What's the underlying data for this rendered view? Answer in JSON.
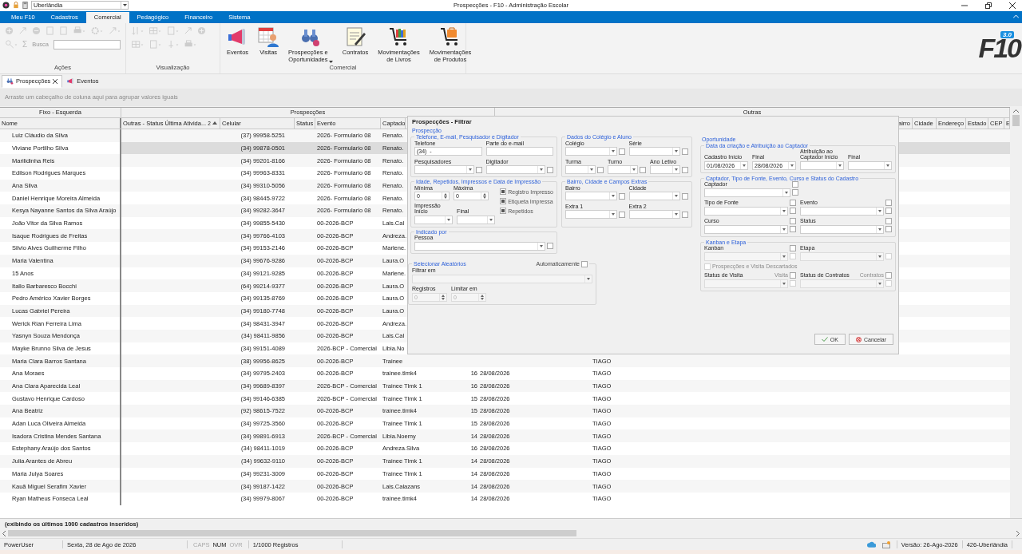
{
  "window": {
    "title": "Prospecções - F10 - Administração Escolar",
    "location": "Uberlândia"
  },
  "ribbon": {
    "tabs": [
      {
        "label": "Meu F10",
        "selected": false
      },
      {
        "label": "Cadastros",
        "selected": false
      },
      {
        "label": "Comercial",
        "selected": true
      },
      {
        "label": "Pedagógico",
        "selected": false
      },
      {
        "label": "Financeiro",
        "selected": false
      },
      {
        "label": "Sistema",
        "selected": false
      }
    ],
    "search_label": "Busca",
    "sum": "Σ",
    "groups": [
      {
        "label": "Ações"
      },
      {
        "label": "Visualização"
      },
      {
        "label": "Comercial"
      }
    ],
    "buttons": [
      {
        "label": "Eventos",
        "kind": "megaphone",
        "dropdown": false
      },
      {
        "label": "Visitas",
        "kind": "calendar",
        "dropdown": false
      },
      {
        "label": "Prospecções e\nOportunidades",
        "kind": "binoculars",
        "dropdown": true
      },
      {
        "label": "Contratos",
        "kind": "contract",
        "dropdown": false
      },
      {
        "label": "Movimentações\nde Livros",
        "kind": "cart-books",
        "dropdown": false
      },
      {
        "label": "Movimentações\nde Produtos",
        "kind": "cart-box",
        "dropdown": false
      }
    ],
    "logo": {
      "text": "F10",
      "version": "3.0"
    }
  },
  "doc_tabs": [
    {
      "label": "Prospecções",
      "selected": true,
      "closable": true
    },
    {
      "label": "Eventos",
      "selected": false,
      "closable": false
    }
  ],
  "group_panel": {
    "hint": "Arraste um cabeçalho de coluna aqui para agrupar valores iguais"
  },
  "grid": {
    "bands": [
      "Fixo - Esquerda",
      "Prospecções",
      "Outras"
    ],
    "columns": [
      "Nome",
      "Outras - Status Última Ativida...",
      "Celular",
      "Status",
      "Evento",
      "Captado"
    ],
    "sort": {
      "index": "2"
    },
    "right_columns": [
      "airro",
      "Cidade",
      "Endereço",
      "Estado",
      "CEP",
      "E"
    ],
    "rows": [
      {
        "nome": "Luiz Cláudio da Silva",
        "celular": "(37) 99958-5251",
        "evento": "2026- Formulario 08",
        "captador": "Renato.",
        "selected": false
      },
      {
        "nome": "Viviane Portilho Silva",
        "celular": "(34) 99878-0501",
        "evento": "2026- Formulario 08",
        "captador": "Renato.",
        "selected": true
      },
      {
        "nome": "Marilidinha Reis",
        "celular": "(34) 99201-8166",
        "evento": "2026- Formulario 08",
        "captador": "Renato.",
        "selected": false
      },
      {
        "nome": "Edilson Rodrigues Marques",
        "celular": "(34) 99963-8331",
        "evento": "2026- Formulario 08",
        "captador": "Renato.",
        "selected": false
      },
      {
        "nome": "Ana Silva",
        "celular": "(34) 99310-5056",
        "evento": "2026- Formulario 08",
        "captador": "Renato.",
        "selected": false
      },
      {
        "nome": "Daniel Henrique Moreira Almeida",
        "celular": "(34) 98445-9722",
        "evento": "2026- Formulario 08",
        "captador": "Renato.",
        "selected": false
      },
      {
        "nome": "Kesya Nayanne Santos da Silva Araújo",
        "celular": "(34) 99282-3647",
        "evento": "2026- Formulario 08",
        "captador": "Renato.",
        "selected": false
      },
      {
        "nome": "João Vitor da Silva Ramos",
        "celular": "(34) 99855-5430",
        "evento": "00-2026-BCP",
        "captador": "Lais.Cal",
        "selected": false
      },
      {
        "nome": "Isaque Rodrigues de Freitas",
        "celular": "(34) 99766-4103",
        "evento": "00-2026-BCP",
        "captador": "Andreza.",
        "selected": false
      },
      {
        "nome": "Silvio Alves Guilherme Filho",
        "celular": "(34) 99153-2146",
        "evento": "00-2026-BCP",
        "captador": "Marlene.",
        "selected": false
      },
      {
        "nome": "Maria Valentina",
        "celular": "(34) 99676-9286",
        "evento": "00-2026-BCP",
        "captador": "Laura.O",
        "selected": false
      },
      {
        "nome": "15 Anos",
        "celular": "(34) 99121-9285",
        "evento": "00-2026-BCP",
        "captador": "Marlene.",
        "selected": false
      },
      {
        "nome": "Itallo Barbaresco Bocchi",
        "celular": "(64) 99214-9377",
        "evento": "00-2026-BCP",
        "captador": "Laura.O",
        "selected": false
      },
      {
        "nome": "Pedro Américo Xavier Borges",
        "celular": "(34) 99135-8769",
        "evento": "00-2026-BCP",
        "captador": "Laura.O",
        "selected": false
      },
      {
        "nome": "Lucas Gabriel Pereira",
        "celular": "(34) 99180-7748",
        "evento": "00-2026-BCP",
        "captador": "Laura.O",
        "selected": false
      },
      {
        "nome": "Werick Rian Ferreira Lima",
        "celular": "(34) 98431-3947",
        "evento": "00-2026-BCP",
        "captador": "Andreza.",
        "selected": false
      },
      {
        "nome": "Yasnyn Souza Mendonça",
        "celular": "(34) 98411-9856",
        "evento": "00-2026-BCP",
        "captador": "Lais.Cal",
        "selected": false
      },
      {
        "nome": "Mayke Brunno Silva de Jesus",
        "celular": "(34) 99151-4089",
        "evento": "2026-BCP - Comercial",
        "captador": "Libia.No",
        "selected": false
      },
      {
        "nome": "Maria Clara Barros Santana",
        "celular": "(38) 99956-8625",
        "evento": "00-2026-BCP",
        "captador": "Trainee",
        "column_9": "TIAGO",
        "selected": false
      },
      {
        "nome": "Ana Moraes",
        "celular": "(34) 99795-2403",
        "evento": "00-2026-BCP",
        "captador": "trainee.tlmk4",
        "column_7": "16",
        "column_8": "28/08/2026",
        "column_9": "TIAGO",
        "selected": false
      },
      {
        "nome": "Ana Clara Aparecida Leal",
        "celular": "(34) 99689-8397",
        "evento": "2026-BCP - Comercial",
        "captador": "Trainee Tlmk 1",
        "column_7": "16",
        "column_8": "28/08/2026",
        "column_9": "TIAGO",
        "selected": false
      },
      {
        "nome": "Gustavo Henrique Cardoso",
        "celular": "(34) 99146-6385",
        "evento": "2026-BCP - Comercial",
        "captador": "Trainee Tlmk 1",
        "column_7": "15",
        "column_8": "28/08/2026",
        "column_9": "TIAGO",
        "selected": false
      },
      {
        "nome": "Ana Beatriz",
        "celular": "(92) 98615-7522",
        "evento": "00-2026-BCP",
        "captador": "trainee.tlmk4",
        "column_7": "15",
        "column_8": "28/08/2026",
        "column_9": "TIAGO",
        "selected": false
      },
      {
        "nome": "Adan Luca Oliveira Almeida",
        "celular": "(34) 99725-3560",
        "evento": "00-2026-BCP",
        "captador": "Trainee Tlmk 1",
        "column_7": "15",
        "column_8": "28/08/2026",
        "column_9": "TIAGO",
        "selected": false
      },
      {
        "nome": "Isadora Cristina Mendes Santana",
        "celular": "(34) 99891-6913",
        "evento": "2026-BCP - Comercial",
        "captador": "Libia.Noemy",
        "column_7": "14",
        "column_8": "28/08/2026",
        "column_9": "TIAGO",
        "selected": false
      },
      {
        "nome": "Estephany Araújo dos Santos",
        "celular": "(34) 98411-1019",
        "evento": "00-2026-BCP",
        "captador": "Andreza.Silva",
        "column_7": "16",
        "column_8": "28/08/2026",
        "column_9": "TIAGO",
        "selected": false
      },
      {
        "nome": "Julia Arantes de Abreu",
        "celular": "(34) 99632-9110",
        "evento": "00-2026-BCP",
        "captador": "Trainee Tlmk 1",
        "column_7": "14",
        "column_8": "28/08/2026",
        "column_9": "TIAGO",
        "selected": false
      },
      {
        "nome": "Maria Julya Soares",
        "celular": "(34) 99231-3009",
        "evento": "00-2026-BCP",
        "captador": "Trainee Tlmk 1",
        "column_7": "14",
        "column_8": "28/08/2026",
        "column_9": "TIAGO",
        "selected": false
      },
      {
        "nome": "Kauã Miguel Serafim Xavier",
        "celular": "(34) 99187-1422",
        "evento": "00-2026-BCP",
        "captador": "Lais.Calazans",
        "column_7": "14",
        "column_8": "28/08/2026",
        "column_9": "TIAGO",
        "selected": false
      },
      {
        "nome": "Ryan Matheus Fonseca Leal",
        "celular": "(34) 99979-8067",
        "evento": "00-2026-BCP",
        "captador": "trainee.tlmk4",
        "column_7": "14",
        "column_8": "28/08/2026",
        "column_9": "TIAGO",
        "selected": false
      }
    ],
    "footer": "(exibindo os últimos 1000 cadastros inseridos)"
  },
  "filter_dialog": {
    "title": "Prospecções - Filtrar",
    "left": {
      "title": "Prospecção",
      "groups": [
        {
          "title": "Telefone, E-mail, Pesquisador e Digitador",
          "rows": [
            [
              {
                "label": "Telefone",
                "kind": "text",
                "value": "(34)  -",
                "disabled": false
              },
              {
                "label": "Parte do e-mail",
                "kind": "text",
                "disabled": false
              }
            ],
            [
              {
                "label": "Pesquisadores",
                "kind": "combo",
                "check": false,
                "disabled": false
              },
              {
                "label": "Digitador",
                "kind": "combo",
                "check": false,
                "disabled": false
              }
            ]
          ]
        },
        {
          "title": "Dados do Colégio e Aluno",
          "rows": [
            [
              {
                "label": "Colégio",
                "kind": "combo",
                "check": false,
                "disabled": false
              },
              {
                "label": "Série",
                "kind": "combo",
                "check": false,
                "disabled": false
              }
            ],
            [
              {
                "label": "Turma",
                "kind": "combo",
                "check": false,
                "disabled": false
              },
              {
                "label": "Turno",
                "kind": "combo",
                "check": false,
                "disabled": false
              },
              {
                "label": "Ano Letivo",
                "kind": "combo",
                "check": false,
                "disabled": false
              }
            ]
          ]
        },
        {
          "title": "Idade, Repetidos, Impressos e Data de Impressão",
          "rows": [
            [
              {
                "label": "Mínima",
                "kind": "spin",
                "value": "0",
                "disabled": false
              },
              {
                "label": "Máxima",
                "kind": "spin",
                "value": "0",
                "disabled": false
              }
            ],
            [
              {
                "label": "Impressão Início",
                "kind": "combo",
                "disabled": false
              },
              {
                "label": "Final",
                "kind": "combo",
                "disabled": false
              }
            ]
          ],
          "checks": [
            {
              "label": "Registro Impresso",
              "indeterminate": true
            },
            {
              "label": "Etiqueta Impressa",
              "indeterminate": true
            },
            {
              "label": "Repetidos",
              "indeterminate": true
            }
          ]
        },
        {
          "title": "Bairro, Cidade e Campos Extras",
          "rows": [
            [
              {
                "label": "Bairro",
                "kind": "combo",
                "check": false,
                "disabled": false
              },
              {
                "label": "Cidade",
                "kind": "combo",
                "check": false,
                "disabled": false
              }
            ],
            [
              {
                "label": "Extra 1",
                "kind": "combo",
                "check": false,
                "disabled": false
              },
              {
                "label": "Extra 2",
                "kind": "combo",
                "check": false,
                "disabled": false
              }
            ]
          ]
        },
        {
          "title": "Indicado por",
          "rows": [
            [
              {
                "label": "Pessoa",
                "kind": "combo",
                "check": false,
                "disabled": false
              }
            ]
          ]
        }
      ]
    },
    "random": {
      "title": "Selecionar Aleatórios",
      "auto": {
        "label": "Automaticamente",
        "checked": false
      },
      "rows": [
        [
          {
            "label": "Filtrar em",
            "kind": "combo",
            "disabled": true
          }
        ],
        [
          {
            "label": "Registros",
            "kind": "spin",
            "value": "0",
            "disabled": true
          },
          {
            "label": "Limitar em",
            "kind": "spin",
            "value": "0",
            "disabled": true
          }
        ]
      ]
    },
    "right": {
      "title": "Oportunidade",
      "groups": [
        {
          "title": "Data da criação e Atribuição ao Captador",
          "rows": [
            [
              {
                "label": "Cadastro Início",
                "kind": "combo",
                "value": "01/08/2026",
                "disabled": false
              },
              {
                "label": "Final",
                "kind": "combo",
                "value": "28/08/2026",
                "disabled": false
              },
              {
                "label": "Atribuição ao Captador Início",
                "kind": "combo",
                "disabled": false
              },
              {
                "label": "Final",
                "kind": "combo",
                "disabled": false
              }
            ]
          ]
        },
        {
          "title": "Captador, Tipo de Fonte, Evento, Curso e Status do Cadastro",
          "rows": [
            [
              {
                "label": "Captador",
                "kind": "combo",
                "check": false,
                "flag": {
                  "checked": false
                },
                "disabled": false
              }
            ],
            [
              {
                "label": "Tipo de Fonte",
                "kind": "combo",
                "check": false,
                "flag": {
                  "checked": false
                },
                "disabled": false
              },
              {
                "label": "Evento",
                "kind": "combo",
                "check": false,
                "flag": {
                  "checked": false
                },
                "disabled": false
              }
            ],
            [
              {
                "label": "Curso",
                "kind": "combo",
                "check": false,
                "flag": {
                  "checked": false
                },
                "disabled": false
              },
              {
                "label": "Status",
                "kind": "combo",
                "check": false,
                "flag": {
                  "checked": false
                },
                "disabled": false
              }
            ]
          ]
        },
        {
          "title": "Kanban e Etapa",
          "rows": [
            [
              {
                "label": "Kanban",
                "kind": "combo",
                "check": false,
                "flag": {
                  "checked": false
                },
                "disabled": true
              },
              {
                "label": "Etapa",
                "kind": "combo",
                "check": false,
                "disabled": true
              }
            ],
            [
              {
                "label": "Prospecções e Visita Descartados",
                "kind": "checkbox",
                "checked": false,
                "disabled": true
              }
            ],
            [
              {
                "label": "Status de Visita",
                "kind": "combo",
                "check": false,
                "flag": {
                  "label": "Visita",
                  "checked": false
                },
                "disabled": true
              },
              {
                "label": "Status de Contratos",
                "kind": "combo",
                "check": false,
                "flag": {
                  "label": "Contratos",
                  "checked": false
                },
                "disabled": true
              }
            ]
          ]
        }
      ]
    },
    "buttons": [
      {
        "label": "OK",
        "kind": "ok"
      },
      {
        "label": "Cancelar",
        "kind": "cancel"
      }
    ]
  },
  "status_bar": {
    "user": "PowerUser",
    "date": "Sexta, 28 de Ago de 2026",
    "indicators": [
      {
        "label": "CAPS",
        "on": false
      },
      {
        "label": "NUM",
        "on": true
      },
      {
        "label": "OVR",
        "on": false
      }
    ],
    "records": "1/1000 Registros",
    "version": "Versão: 26-Ago-2026",
    "unit": "426-Uberlândia"
  }
}
